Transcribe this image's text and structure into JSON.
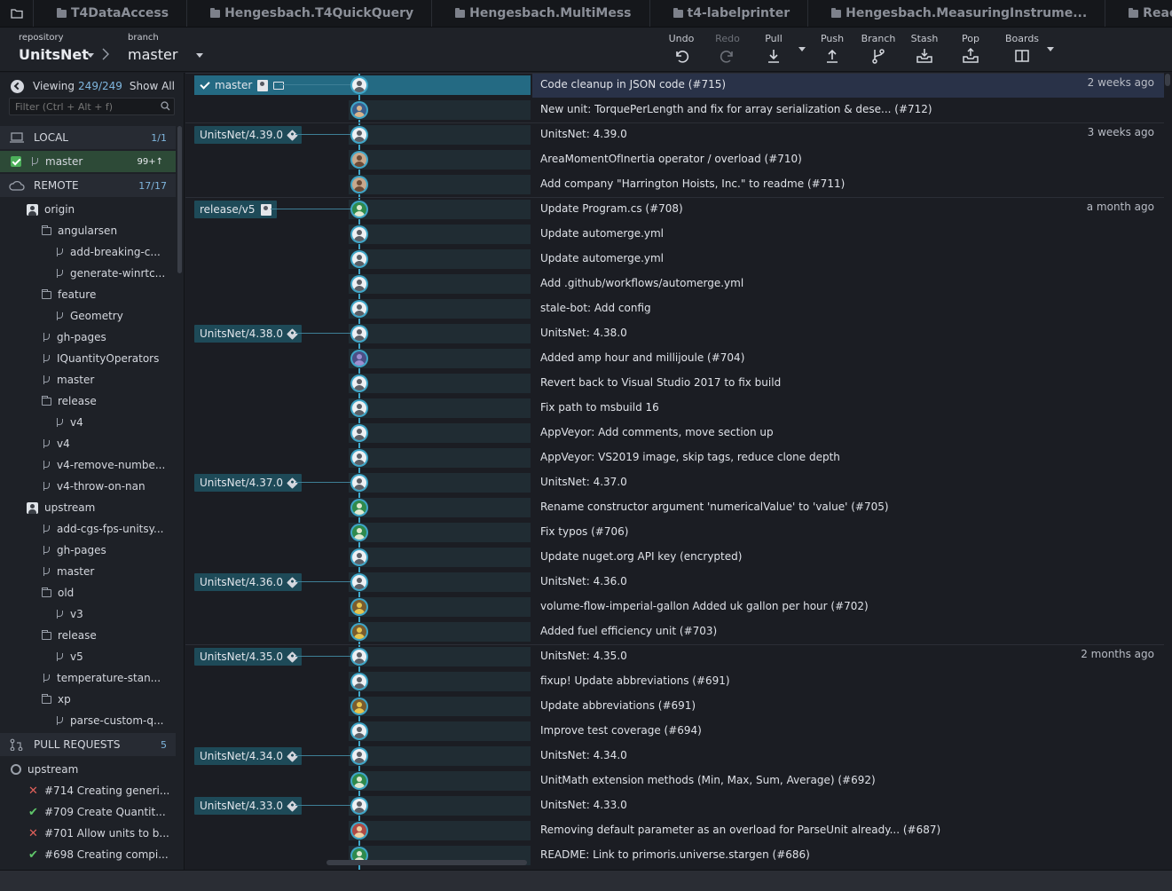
{
  "tabs": [
    {
      "label": "T4DataAccess"
    },
    {
      "label": "Hengesbach.T4QuickQuery"
    },
    {
      "label": "Hengesbach.MultiMess"
    },
    {
      "label": "t4-labelprinter"
    },
    {
      "label": "Hengesbach.MeasuringInstrume..."
    },
    {
      "label": "ReactiveUI"
    }
  ],
  "toolbar": {
    "repository_caption": "repository",
    "repository_name": "UnitsNet",
    "branch_caption": "branch",
    "branch_name": "master",
    "undo": "Undo",
    "redo": "Redo",
    "pull": "Pull",
    "push": "Push",
    "branch": "Branch",
    "stash": "Stash",
    "pop": "Pop",
    "boards": "Boards"
  },
  "left_panel": {
    "viewing_label": "Viewing",
    "viewing_count": "249/249",
    "show_all": "Show All",
    "filter_placeholder": "Filter (Ctrl + Alt + f)",
    "local": {
      "title": "LOCAL",
      "count": "1/1"
    },
    "local_branch": {
      "name": "master",
      "badge": "99+↑"
    },
    "remote": {
      "title": "REMOTE",
      "count": "17/17"
    },
    "remote_tree": [
      {
        "label": "origin",
        "icon": "avatar-icon",
        "depth": 0
      },
      {
        "label": "angularsen",
        "icon": "folder-icon",
        "depth": 1
      },
      {
        "label": "add-breaking-c...",
        "icon": "branch-icon",
        "depth": 2
      },
      {
        "label": "generate-winrtc...",
        "icon": "branch-icon",
        "depth": 2
      },
      {
        "label": "feature",
        "icon": "folder-icon",
        "depth": 1
      },
      {
        "label": "Geometry",
        "icon": "branch-icon",
        "depth": 2
      },
      {
        "label": "gh-pages",
        "icon": "branch-icon",
        "depth": 1
      },
      {
        "label": "IQuantityOperators",
        "icon": "branch-icon",
        "depth": 1
      },
      {
        "label": "master",
        "icon": "branch-icon",
        "depth": 1
      },
      {
        "label": "release",
        "icon": "folder-icon",
        "depth": 1
      },
      {
        "label": "v4",
        "icon": "branch-icon",
        "depth": 2
      },
      {
        "label": "v4",
        "icon": "branch-icon",
        "depth": 1
      },
      {
        "label": "v4-remove-numbe...",
        "icon": "branch-icon",
        "depth": 1
      },
      {
        "label": "v4-throw-on-nan",
        "icon": "branch-icon",
        "depth": 1
      },
      {
        "label": "upstream",
        "icon": "avatar-icon",
        "depth": 0
      },
      {
        "label": "add-cgs-fps-unitsy...",
        "icon": "branch-icon",
        "depth": 1
      },
      {
        "label": "gh-pages",
        "icon": "branch-icon",
        "depth": 1
      },
      {
        "label": "master",
        "icon": "branch-icon",
        "depth": 1
      },
      {
        "label": "old",
        "icon": "folder-icon",
        "depth": 1
      },
      {
        "label": "v3",
        "icon": "branch-icon",
        "depth": 2
      },
      {
        "label": "release",
        "icon": "folder-icon",
        "depth": 1
      },
      {
        "label": "v5",
        "icon": "branch-icon",
        "depth": 2
      },
      {
        "label": "temperature-stan...",
        "icon": "branch-icon",
        "depth": 1
      },
      {
        "label": "xp",
        "icon": "folder-icon",
        "depth": 1
      },
      {
        "label": "parse-custom-q...",
        "icon": "branch-icon",
        "depth": 2
      }
    ],
    "pull_requests": {
      "title": "PULL REQUESTS",
      "count": "5"
    },
    "pr_remote": "upstream",
    "pr_items": [
      {
        "label": "#714 Creating generi...",
        "status": "failed"
      },
      {
        "label": "#709 Create Quantit...",
        "status": "passed"
      },
      {
        "label": "#701 Allow units to b...",
        "status": "failed"
      },
      {
        "label": "#698 Creating compi...",
        "status": "passed"
      }
    ]
  },
  "commits": [
    {
      "message": "Code cleanup in JSON code (#715)",
      "time": "2 weeks ago",
      "ref": "master",
      "ref_type": "branch",
      "selected": true,
      "avatar": 0
    },
    {
      "message": "New unit: TorquePerLength and fix for array serialization & dese... (#712)",
      "time": "",
      "avatar": 1
    },
    {
      "message": "UnitsNet: 4.39.0",
      "time": "3 weeks ago",
      "ref": "UnitsNet/4.39.0",
      "ref_type": "tag",
      "avatar": 0
    },
    {
      "message": "AreaMomentOfInertia operator / overload (#710)",
      "time": "",
      "avatar": 2
    },
    {
      "message": "Add company \"Harrington Hoists, Inc.\" to readme (#711)",
      "time": "",
      "avatar": 2
    },
    {
      "message": "Update Program.cs (#708)",
      "time": "a month ago",
      "ref": "release/v5",
      "ref_type": "remote",
      "avatar": 3
    },
    {
      "message": "Update automerge.yml",
      "time": "",
      "avatar": 0
    },
    {
      "message": "Update automerge.yml",
      "time": "",
      "avatar": 0
    },
    {
      "message": "Add .github/workflows/automerge.yml",
      "time": "",
      "avatar": 0
    },
    {
      "message": "stale-bot: Add config",
      "time": "",
      "avatar": 0
    },
    {
      "message": "UnitsNet: 4.38.0",
      "time": "",
      "ref": "UnitsNet/4.38.0",
      "ref_type": "tag",
      "avatar": 0
    },
    {
      "message": "Added amp hour and millijoule (#704)",
      "time": "",
      "avatar": 4
    },
    {
      "message": "Revert back to Visual Studio 2017 to fix build",
      "time": "",
      "avatar": 0
    },
    {
      "message": "Fix path to msbuild 16",
      "time": "",
      "avatar": 0
    },
    {
      "message": "AppVeyor: Add comments, move section up",
      "time": "",
      "avatar": 0
    },
    {
      "message": "AppVeyor: VS2019 image, skip tags, reduce clone depth",
      "time": "",
      "avatar": 0
    },
    {
      "message": "UnitsNet: 4.37.0",
      "time": "",
      "ref": "UnitsNet/4.37.0",
      "ref_type": "tag",
      "avatar": 0
    },
    {
      "message": "Rename constructor argument 'numericalValue' to 'value' (#705)",
      "time": "",
      "avatar": 3
    },
    {
      "message": "Fix typos (#706)",
      "time": "",
      "avatar": 3
    },
    {
      "message": "Update nuget.org API key (encrypted)",
      "time": "",
      "avatar": 0
    },
    {
      "message": "UnitsNet: 4.36.0",
      "time": "",
      "ref": "UnitsNet/4.36.0",
      "ref_type": "tag",
      "avatar": 0
    },
    {
      "message": "volume-flow-imperial-gallon Added uk gallon per hour (#702)",
      "time": "",
      "avatar": 5
    },
    {
      "message": "Added fuel efficiency unit (#703)",
      "time": "",
      "avatar": 5
    },
    {
      "message": "UnitsNet: 4.35.0",
      "time": "2 months ago",
      "ref": "UnitsNet/4.35.0",
      "ref_type": "tag",
      "avatar": 0
    },
    {
      "message": "fixup! Update abbreviations (#691)",
      "time": "",
      "avatar": 0
    },
    {
      "message": "Update abbreviations (#691)",
      "time": "",
      "avatar": 5
    },
    {
      "message": "Improve test coverage (#694)",
      "time": "",
      "avatar": 0
    },
    {
      "message": "UnitsNet: 4.34.0",
      "time": "",
      "ref": "UnitsNet/4.34.0",
      "ref_type": "tag",
      "avatar": 0
    },
    {
      "message": "UnitMath extension methods (Min, Max, Sum, Average) (#692)",
      "time": "",
      "avatar": 3
    },
    {
      "message": "UnitsNet: 4.33.0",
      "time": "",
      "ref": "UnitsNet/4.33.0",
      "ref_type": "tag",
      "avatar": 0
    },
    {
      "message": "Removing default parameter as an overload for ParseUnit already... (#687)",
      "time": "",
      "avatar": 6
    },
    {
      "message": "README: Link to primoris.universe.stargen (#686)",
      "time": "",
      "avatar": 3
    }
  ],
  "colors": {
    "accent": "#3fa6c8",
    "selected_row": "#293248",
    "tag_bg": "#1e4a58",
    "local_selected": "#2d4a37"
  }
}
